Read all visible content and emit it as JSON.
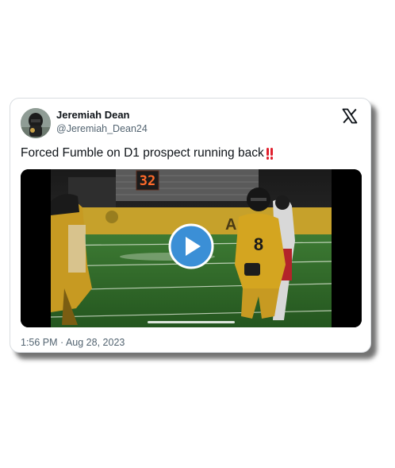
{
  "tweet": {
    "author_name": "Jeremiah Dean",
    "author_handle": "@Jeremiah_Dean24",
    "text": "Forced Fumble on D1 prospect running back",
    "text_emoji": "double-exclamation-mark",
    "timestamp": "1:56 PM · Aug 28, 2023"
  },
  "video": {
    "scoreboard_number": "32",
    "jersey_number": "8",
    "banner_text": "AOL",
    "play_icon": "play-icon"
  },
  "icons": {
    "platform_logo": "x-logo-icon",
    "avatar": "avatar"
  },
  "colors": {
    "play_button": "#3b8fd6",
    "emoji_red": "#e0202e",
    "jersey_gold": "#d4a520",
    "field_green": "#2e6b2a",
    "name_text": "#0f1419",
    "secondary_text": "#536471"
  }
}
